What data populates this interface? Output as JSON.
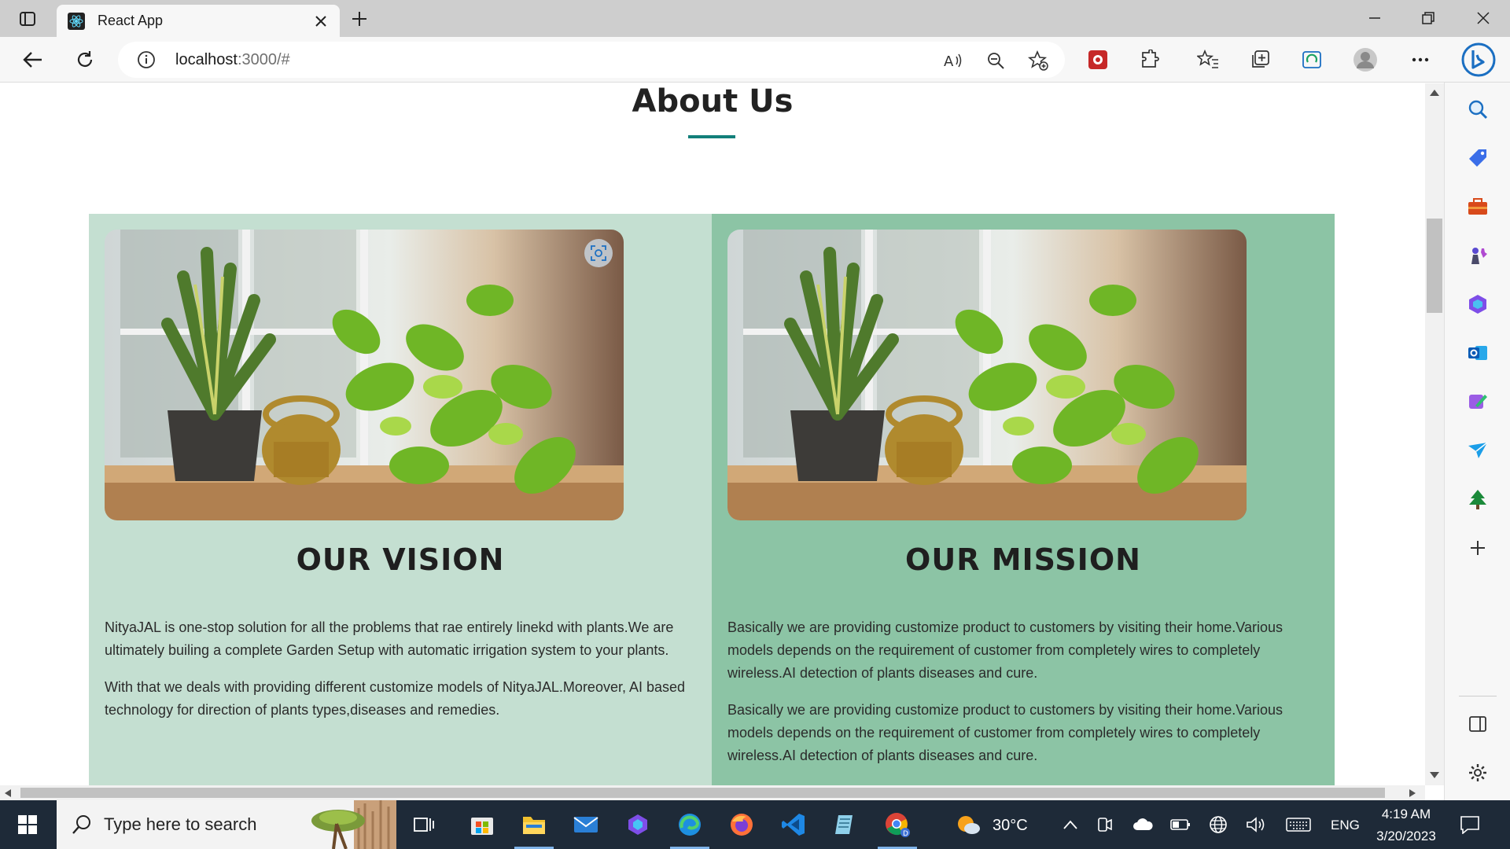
{
  "browser": {
    "tab_title": "React App",
    "url_host": "localhost",
    "url_path": ":3000/#"
  },
  "page": {
    "title": "About Us",
    "vision": {
      "heading": "OUR VISION",
      "paragraphs": [
        "NityaJAL is one-stop solution for all the problems that rae entirely linekd with plants.We are ultimately builing a complete Garden Setup with automatic irrigation system to your plants.",
        "With that we deals with providing different customize models of NityaJAL.Moreover, AI based technology for direction of plants types,diseases and remedies."
      ]
    },
    "mission": {
      "heading": "OUR MISSION",
      "paragraphs": [
        "Basically we are providing customize product to customers by visiting their home.Various models depends on the requirement of customer from completely wires to completely wireless.AI detection of plants diseases and cure.",
        "Basically we are providing customize product to customers by visiting their home.Various models depends on the requirement of customer from completely wires to completely wireless.AI detection of plants diseases and cure."
      ]
    }
  },
  "taskbar": {
    "search_placeholder": "Type here to search",
    "weather": "30°C",
    "language": "ENG",
    "time": "4:19 AM",
    "date": "3/20/2023"
  },
  "colors": {
    "vision_bg": "#c4dfd1",
    "mission_bg": "#8cc4a5",
    "accent": "#127f7a"
  }
}
